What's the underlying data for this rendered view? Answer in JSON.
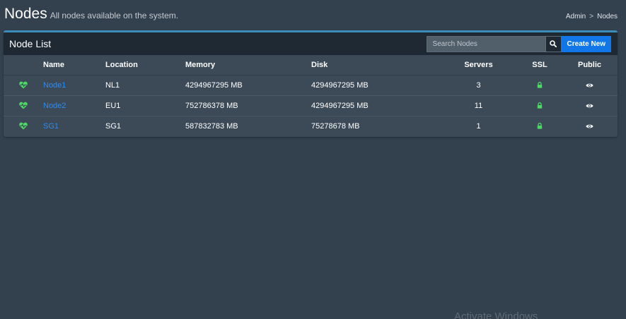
{
  "header": {
    "title": "Nodes",
    "subtitle": "All nodes available on the system.",
    "breadcrumb": [
      "Admin",
      "Nodes"
    ],
    "breadcrumb_separator": ">"
  },
  "box": {
    "title": "Node List",
    "search_placeholder": "Search Nodes",
    "search_icon": "search-icon",
    "create_label": "Create New"
  },
  "table": {
    "columns": [
      "Name",
      "Location",
      "Memory",
      "Disk",
      "Servers",
      "SSL",
      "Public"
    ],
    "rows": [
      {
        "status_icon": "heartbeat-icon",
        "name": "Node1",
        "location": "NL1",
        "memory": "4294967295 MB",
        "disk": "4294967295 MB",
        "servers": "3",
        "ssl_icon": "lock-icon",
        "public_icon": "eye-icon"
      },
      {
        "status_icon": "heartbeat-icon",
        "name": "Node2",
        "location": "EU1",
        "memory": "752786378 MB",
        "disk": "4294967295 MB",
        "servers": "11",
        "ssl_icon": "lock-icon",
        "public_icon": "eye-icon"
      },
      {
        "status_icon": "heartbeat-icon",
        "name": "SG1",
        "location": "SG1",
        "memory": "587832783 MB",
        "disk": "75278678 MB",
        "servers": "1",
        "ssl_icon": "lock-icon",
        "public_icon": "eye-icon"
      }
    ]
  },
  "watermark": "Activate Windows",
  "colors": {
    "background": "#33404d",
    "panel": "#3c4a57",
    "panel_header": "#1f2933",
    "accent": "#3c8dbc",
    "primary_button": "#1177e8",
    "link": "#2d8cf0",
    "status_green": "#4cd964"
  }
}
